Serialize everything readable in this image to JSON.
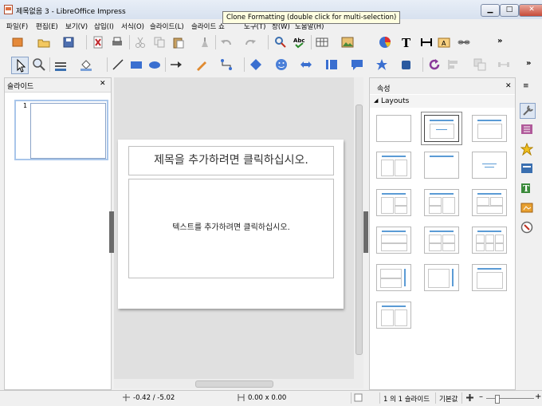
{
  "window": {
    "title": "제목없음 3 - LibreOffice Impress",
    "minimize": "▁",
    "maximize": "□",
    "close": "✕"
  },
  "tooltip": "Clone Formatting (double click for multi-selection)",
  "menu": [
    "파일(F)",
    "편집(E)",
    "보기(V)",
    "삽입(I)",
    "서식(O)",
    "슬라이드(L)",
    "슬라이드 쇼",
    "도구(T)",
    "창(W)",
    "도움말(H)"
  ],
  "toolbar": {
    "more": "»"
  },
  "slides_panel": {
    "title": "슬라이드",
    "close": "✕",
    "thumb_number": "1"
  },
  "slide": {
    "title_placeholder": "제목을 추가하려면 클릭하십시오.",
    "body_placeholder": "텍스트를 추가하려면 클릭하십시오."
  },
  "properties": {
    "title": "속성",
    "close": "✕",
    "section": "Layouts",
    "section_toggle": "◢"
  },
  "deck": {
    "menu": "≡"
  },
  "status": {
    "position": "-0.42 / -5.02",
    "size": "0.00 x 0.00",
    "slide_info": "1 의 1 슬라이드",
    "master": "기본값",
    "zoom_minus": "–",
    "zoom_plus": "+"
  },
  "colors": {
    "accent": "#5b9bd5",
    "selection": "#a9c6ea"
  }
}
